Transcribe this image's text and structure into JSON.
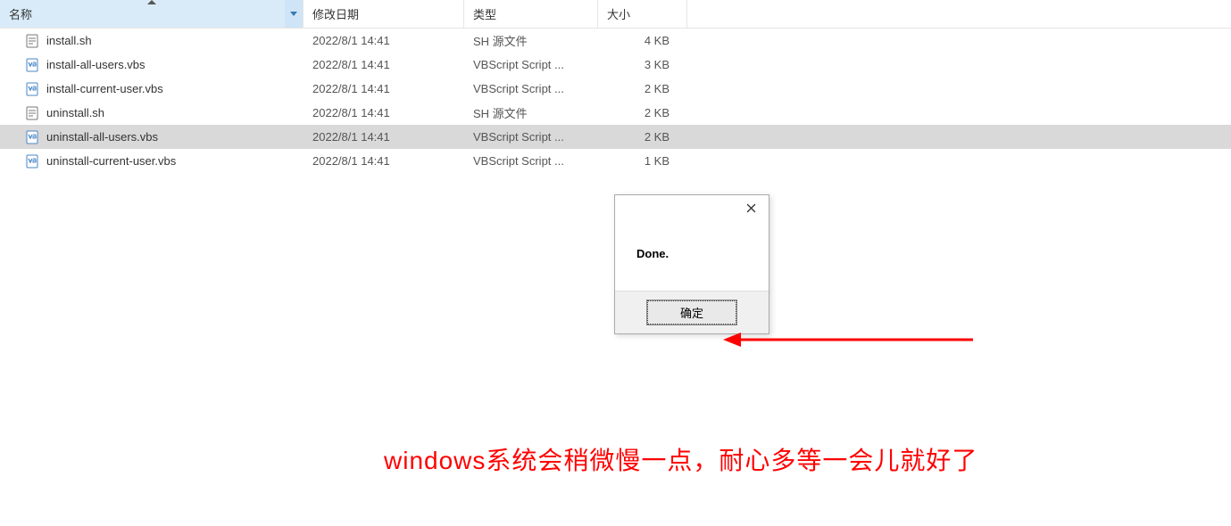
{
  "columns": {
    "name": "名称",
    "date": "修改日期",
    "type": "类型",
    "size": "大小"
  },
  "files": [
    {
      "icon": "sh",
      "name": "install.sh",
      "date": "2022/8/1 14:41",
      "type": "SH 源文件",
      "size": "4 KB",
      "selected": false
    },
    {
      "icon": "vbs",
      "name": "install-all-users.vbs",
      "date": "2022/8/1 14:41",
      "type": "VBScript Script ...",
      "size": "3 KB",
      "selected": false
    },
    {
      "icon": "vbs",
      "name": "install-current-user.vbs",
      "date": "2022/8/1 14:41",
      "type": "VBScript Script ...",
      "size": "2 KB",
      "selected": false
    },
    {
      "icon": "sh",
      "name": "uninstall.sh",
      "date": "2022/8/1 14:41",
      "type": "SH 源文件",
      "size": "2 KB",
      "selected": false
    },
    {
      "icon": "vbs",
      "name": "uninstall-all-users.vbs",
      "date": "2022/8/1 14:41",
      "type": "VBScript Script ...",
      "size": "2 KB",
      "selected": true
    },
    {
      "icon": "vbs",
      "name": "uninstall-current-user.vbs",
      "date": "2022/8/1 14:41",
      "type": "VBScript Script ...",
      "size": "1 KB",
      "selected": false
    }
  ],
  "dialog": {
    "message": "Done.",
    "ok_label": "确定"
  },
  "caption": "windows系统会稍微慢一点，耐心多等一会儿就好了"
}
